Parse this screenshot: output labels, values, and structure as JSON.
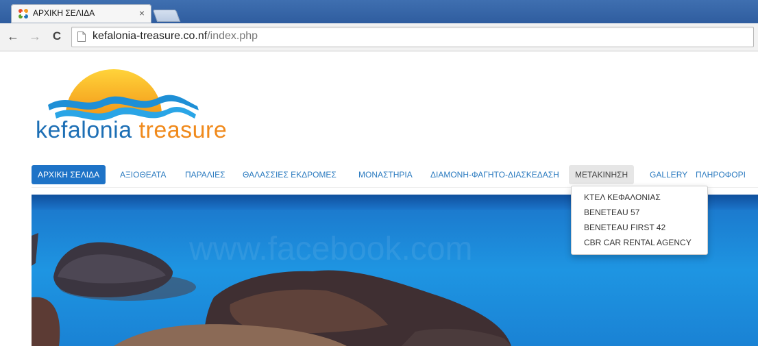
{
  "browser": {
    "tab": {
      "title": "ΑΡΧΙΚΗ ΣΕΛΙΔΑ",
      "close": "×",
      "favicon": "joomla-icon"
    },
    "nav": {
      "back": "←",
      "forward": "→",
      "reload": "C"
    },
    "address": {
      "host": "kefalonia-treasure.co.nf",
      "path": "/index.php"
    }
  },
  "logo": {
    "word1": "kefalonia",
    "word2": "treasure"
  },
  "menu": {
    "items": [
      {
        "label": "ΑΡΧΙΚΗ ΣΕΛΙΔΑ"
      },
      {
        "label": "ΑΞΙΟΘΕΑΤΑ"
      },
      {
        "label": "ΠΑΡΑΛΙΕΣ"
      },
      {
        "label": "ΘΑΛΑΣΣΙΕΣ ΕΚΔΡΟΜΕΣ"
      },
      {
        "label": "ΜΟΝΑΣΤΗΡΙΑ"
      },
      {
        "label": "ΔΙΑΜΟΝΗ-ΦΑΓΗΤΟ-ΔΙΑΣΚΕΔΑΣΗ"
      },
      {
        "label": "ΜΕΤΑΚΙΝΗΣΗ"
      },
      {
        "label": "GALLERY"
      },
      {
        "label": "ΠΛΗΡΟΦΟΡΙ"
      }
    ],
    "dropdown": [
      {
        "label": "ΚΤΕΛ ΚΕΦΑΛΟΝΙΑΣ"
      },
      {
        "label": "BENETEAU 57"
      },
      {
        "label": "BENETEAU FIRST 42"
      },
      {
        "label": "CBR CAR RENTAL AGENCY"
      }
    ]
  },
  "colors": {
    "accent": "#1e73c7",
    "link": "#2a7abf",
    "logo_blue": "#1d6fb5",
    "logo_orange": "#f08a1c"
  }
}
